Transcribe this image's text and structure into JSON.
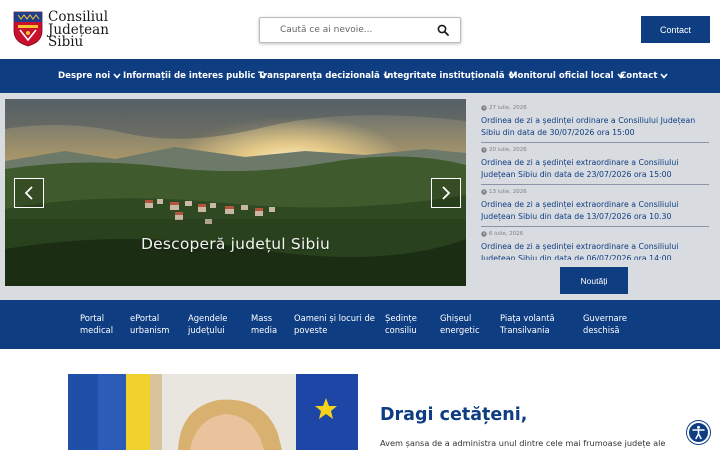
{
  "logo": {
    "line1": "Consiliul",
    "line2": "Județean",
    "line3": "Sibiu"
  },
  "search": {
    "placeholder": "Caută ce ai nevoie..."
  },
  "header": {
    "contact_label": "Contact"
  },
  "nav": {
    "items": [
      {
        "label": "Despre noi"
      },
      {
        "label": "Informații de interes public"
      },
      {
        "label": "Transparența decizională"
      },
      {
        "label": "Integritate instituțională"
      },
      {
        "label": "Monitorul oficial local"
      },
      {
        "label": "Contact"
      }
    ]
  },
  "slider": {
    "caption": "Descoperă județul Sibiu"
  },
  "news": {
    "items": [
      {
        "date": "27 iulie, 2026",
        "title": "Ordinea de zi a ședinței ordinare a Consiliului Județean Sibiu din data de 30/07/2026 ora 15:00"
      },
      {
        "date": "20 iulie, 2026",
        "title": "Ordinea de zi a ședinței extraordinare a Consiliului Județean Sibiu din data de 23/07/2026 ora 15:00"
      },
      {
        "date": "13 iulie, 2026",
        "title": "Ordinea de zi a ședinței extraordinare a Consiliului Județean Sibiu din data de 13/07/2026 ora 10.30"
      },
      {
        "date": "6 iulie, 2026",
        "title": "Ordinea de zi a ședinței extraordinare a Consiliului Județean Sibiu din data de 06/07/2026 ora 14:00"
      }
    ],
    "button_label": "Noutăți"
  },
  "quick_links": [
    {
      "line1": "Portal",
      "line2": "medical"
    },
    {
      "line1": "ePortal",
      "line2": "urbanism"
    },
    {
      "line1": "Agendele",
      "line2": "județului"
    },
    {
      "line1": "Mass",
      "line2": "media"
    },
    {
      "line1": "Oameni și locuri de",
      "line2": "poveste"
    },
    {
      "line1": "Ședințe",
      "line2": "consiliu"
    },
    {
      "line1": "Ghișeul",
      "line2": "energetic"
    },
    {
      "line1": "Piața volantă",
      "line2": "Transilvania"
    },
    {
      "line1": "Guvernare",
      "line2": "deschisă"
    }
  ],
  "welcome": {
    "title": "Dragi cetățeni,",
    "text": "Avem șansa de a administra unul dintre cele mai frumoase județe ale"
  },
  "colors": {
    "primary": "#0e3d82",
    "band": "#d8dbe0"
  },
  "icons": {
    "search": "search-icon",
    "chevron": "chevron-down-icon",
    "clock": "clock-icon",
    "accessibility": "accessibility-icon"
  }
}
